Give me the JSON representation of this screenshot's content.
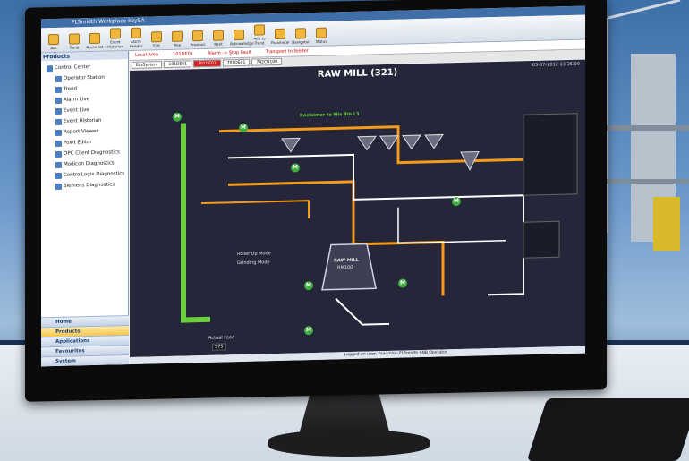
{
  "window": {
    "title": "FLSmidth Workplace keySA"
  },
  "ribbon": {
    "buttons": [
      "Ack",
      "Trend",
      "Alarm list",
      "Event Historian",
      "Alarm Header",
      "Edit",
      "Tree",
      "Previous",
      "Next",
      "Acknowledge",
      "Add to Trend",
      "Parameter",
      "Navigator",
      "Status"
    ]
  },
  "sidebar": {
    "header": "Products",
    "items": [
      "Control Center",
      "Operator Station",
      "Trend",
      "Alarm Live",
      "Event Live",
      "Event Historian",
      "Report Viewer",
      "Point Editor",
      "OPC Client Diagnostics",
      "Modicon Diagnostics",
      "ControlLogix Diagnostics",
      "Siemens Diagnostics"
    ],
    "nav": [
      "Home",
      "Products",
      "Applications",
      "Favourites",
      "System"
    ]
  },
  "alarmbar": {
    "area": "Local Area",
    "code": "101DE01",
    "alarm": "Alarm -> Stop Fault",
    "transport": "Transport to feeder"
  },
  "tabs": [
    "EcsSystem",
    "101DE01",
    "101DE01",
    "701DE01",
    "742CU100"
  ],
  "hmi": {
    "title": "RAW MILL (321)",
    "date": "05-07-2012 13:35:00",
    "reclaimer": "Reclaimer to Mix Bin L3",
    "roller_mode": "Roller Up Mode",
    "grinding_mode": "Grinding Mode",
    "raw_mill": "RAW MILL",
    "raw_mill_tag": "RM100",
    "actual_feed_label": "Actual Feed",
    "actual_feed_value": "575"
  },
  "statusbar": {
    "text": "Logged on user: Fsadmin - FLSmidth SNB Operator"
  },
  "colors": {
    "hmi_bg": "#25263a",
    "flow_orange": "#f59a1a",
    "flow_white": "#ffffff",
    "motor_green": "#3fae3f",
    "conveyor_green": "#6ccf3c"
  }
}
